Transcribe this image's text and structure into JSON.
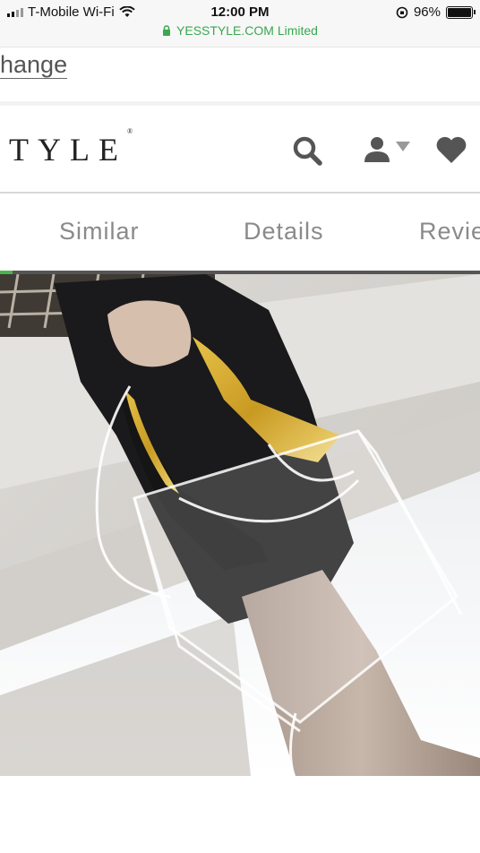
{
  "status_bar": {
    "carrier": "T-Mobile Wi-Fi",
    "time": "12:00 PM",
    "battery": "96%",
    "url": "YESSTYLE.COM Limited"
  },
  "nav": {
    "change_link": "hange"
  },
  "header": {
    "logo": "TYLE",
    "logo_mark": "®"
  },
  "tabs": [
    "Similar",
    "Details",
    "Revie"
  ],
  "colors": {
    "accent_green": "#49b649",
    "url_green": "#3aa850",
    "icon_gray": "#555555"
  },
  "icons": [
    "search-icon",
    "account-icon",
    "caret-down-icon",
    "heart-icon",
    "lock-icon",
    "wifi-icon"
  ]
}
